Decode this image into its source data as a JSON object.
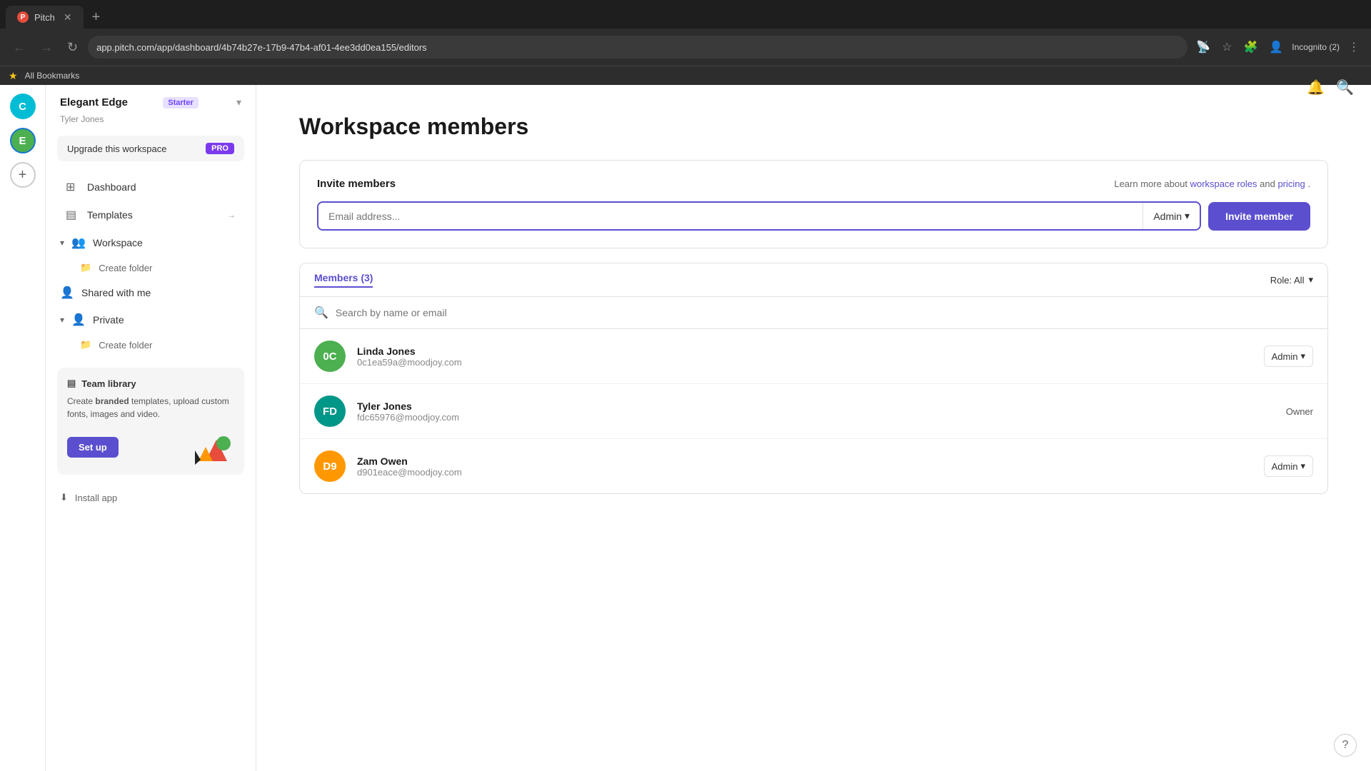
{
  "browser": {
    "tab_title": "Pitch",
    "tab_favicon": "P",
    "address_bar": "app.pitch.com/app/dashboard/4b74b27e-17b9-47b4-af01-4ee3dd0ea155/editors",
    "incognito_label": "Incognito (2)",
    "bookmarks_label": "All Bookmarks",
    "new_tab_symbol": "+"
  },
  "icon_bar": {
    "workspace_initial": "C",
    "active_workspace_initial": "E",
    "add_workspace_symbol": "+"
  },
  "sidebar": {
    "workspace_name": "Elegant Edge",
    "workspace_plan": "Starter",
    "user_name": "Tyler Jones",
    "upgrade_label": "Upgrade this workspace",
    "pro_label": "PRO",
    "nav_items": [
      {
        "id": "dashboard",
        "label": "Dashboard",
        "icon": "⊞"
      },
      {
        "id": "templates",
        "label": "Templates",
        "icon": "⊟",
        "arrow": "→"
      }
    ],
    "workspace_section": {
      "label": "Workspace",
      "icon": "👥",
      "sub_items": [
        {
          "id": "create-folder",
          "label": "Create folder",
          "icon": "📁"
        }
      ]
    },
    "shared_with_me": {
      "label": "Shared with me",
      "icon": "👤"
    },
    "private_section": {
      "label": "Private",
      "icon": "👤",
      "sub_items": [
        {
          "id": "create-folder-private",
          "label": "Create folder",
          "icon": "📁"
        }
      ]
    },
    "team_library": {
      "header": "Team library",
      "description_parts": [
        "Create ",
        "branded",
        " templates, upload custom fonts, images and video."
      ],
      "setup_label": "Set up"
    },
    "install_app": {
      "label": "Install app",
      "icon": "⬇"
    }
  },
  "main": {
    "page_title": "Workspace members",
    "invite_section": {
      "title": "Invite members",
      "learn_more_prefix": "Learn more about ",
      "workspace_roles_link": "workspace roles",
      "and_text": " and ",
      "pricing_link": "pricing",
      "learn_more_suffix": ".",
      "email_placeholder": "Email address...",
      "role_label": "Admin",
      "invite_button": "Invite member"
    },
    "members_section": {
      "tab_label": "Members (3)",
      "role_filter_label": "Role: All",
      "search_placeholder": "Search by name or email",
      "members": [
        {
          "id": "linda-jones",
          "initials": "0C",
          "name": "Linda Jones",
          "email": "0c1ea59a@moodjoy.com",
          "role": "Admin",
          "avatar_color": "avatar-green"
        },
        {
          "id": "tyler-jones",
          "initials": "FD",
          "name": "Tyler Jones",
          "email": "fdc65976@moodjoy.com",
          "role": "Owner",
          "avatar_color": "avatar-teal",
          "role_only": true
        },
        {
          "id": "zam-owen",
          "initials": "D9",
          "name": "Zam Owen",
          "email": "d901eace@moodjoy.com",
          "role": "Admin",
          "avatar_color": "avatar-orange"
        }
      ]
    }
  }
}
